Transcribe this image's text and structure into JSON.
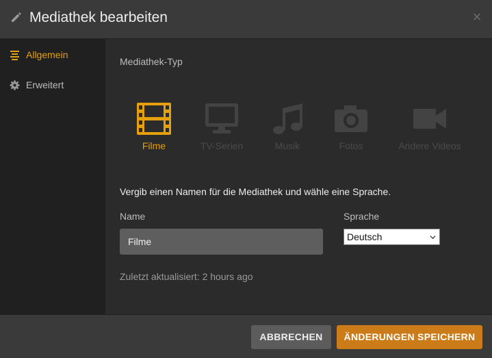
{
  "dialog": {
    "title": "Mediathek bearbeiten",
    "close_icon": "×"
  },
  "sidebar": {
    "items": [
      {
        "label": "Allgemein",
        "icon": "list-icon",
        "active": true
      },
      {
        "label": "Erweitert",
        "icon": "gear-icon",
        "active": false
      }
    ]
  },
  "main": {
    "section_label": "Mediathek-Typ",
    "types": [
      {
        "label": "Filme",
        "icon": "film-icon",
        "selected": true
      },
      {
        "label": "TV-Serien",
        "icon": "tv-icon",
        "selected": false
      },
      {
        "label": "Musik",
        "icon": "music-icon",
        "selected": false
      },
      {
        "label": "Fotos",
        "icon": "camera-icon",
        "selected": false
      },
      {
        "label": "Andere Videos",
        "icon": "video-camera-icon",
        "selected": false
      }
    ],
    "hint": "Vergib einen Namen für die Mediathek und wähle eine Sprache.",
    "name_label": "Name",
    "name_value": "Filme",
    "language_label": "Sprache",
    "language_value": "Deutsch",
    "updated_text": "Zuletzt aktualisiert: 2 hours ago"
  },
  "footer": {
    "cancel_label": "ABBRECHEN",
    "save_label": "ÄNDERUNGEN SPEICHERN"
  },
  "colors": {
    "accent": "#e5a00d",
    "save_button": "#cc7b19",
    "cancel_button": "#5c5c5c"
  }
}
